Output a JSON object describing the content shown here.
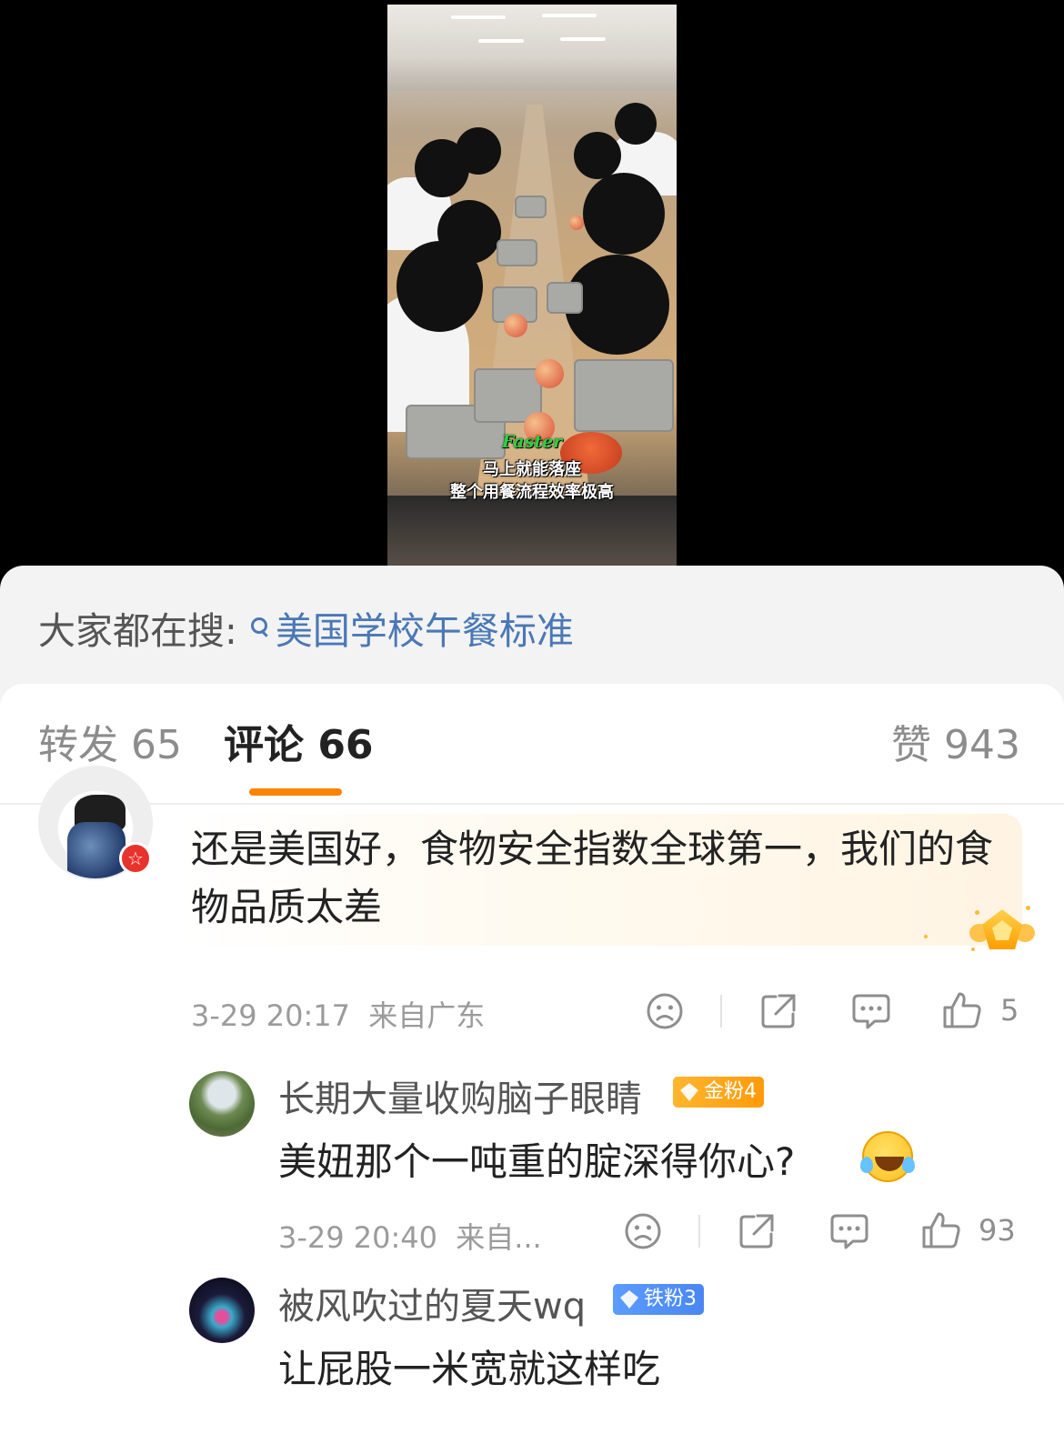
{
  "video": {
    "caption_en": "Faster",
    "caption_line1": "马上就能落座",
    "caption_line2": "整个用餐流程效率极高"
  },
  "search": {
    "prefix": "大家都在搜:",
    "query": "美国学校午餐标准"
  },
  "tabs": {
    "repost": "转发 65",
    "comments": "评论 66",
    "likes": "赞 943"
  },
  "comment": {
    "text": "还是美国好，食物安全指数全球第一，我们的食物品质太差",
    "time": "3-29 20:17",
    "location": "来自广东",
    "likes": "5"
  },
  "replies": [
    {
      "name": "长期大量收购脑子眼睛",
      "badge": "金粉4",
      "text": "美妞那个一吨重的腚深得你心?",
      "time": "3-29 20:40",
      "location": "来自...",
      "likes": "93"
    },
    {
      "name": "被风吹过的夏天wq",
      "badge": "铁粉3",
      "text": "让屁股一米宽就这样吃"
    }
  ],
  "colors": {
    "accent": "#ff8200",
    "link": "#4a78b6",
    "gold_badge": "#ffa31a",
    "iron_badge": "#4f8ef7"
  }
}
